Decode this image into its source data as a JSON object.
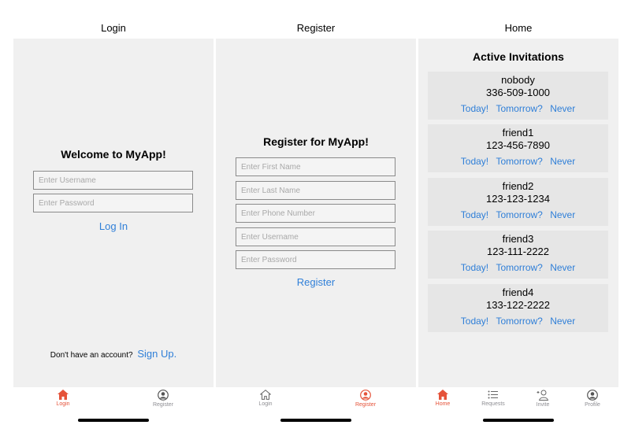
{
  "colors": {
    "accent": "#e5533a",
    "link": "#2f7fd8",
    "inactive": "#8e8e93",
    "background": "#f0f0f0"
  },
  "login": {
    "nav_title": "Login",
    "heading": "Welcome to MyApp!",
    "username_placeholder": "Enter Username",
    "password_placeholder": "Enter Password",
    "login_label": "Log In",
    "no_account_text": "Don't have an account?",
    "signup_label": "Sign Up.",
    "tabs": [
      {
        "label": "Login",
        "icon": "home-icon",
        "active": true
      },
      {
        "label": "Register",
        "icon": "user-circle-icon",
        "active": false
      }
    ]
  },
  "register": {
    "nav_title": "Register",
    "heading": "Register for MyApp!",
    "first_name_placeholder": "Enter First Name",
    "last_name_placeholder": "Enter Last Name",
    "phone_placeholder": "Enter Phone Number",
    "username_placeholder": "Enter Username",
    "password_placeholder": "Enter Password",
    "register_label": "Register",
    "tabs": [
      {
        "label": "Login",
        "icon": "home-icon",
        "active": false
      },
      {
        "label": "Register",
        "icon": "user-circle-icon",
        "active": true
      }
    ]
  },
  "home": {
    "nav_title": "Home",
    "heading": "Active Invitations",
    "invitations": [
      {
        "name": "nobody",
        "phone": "336-509-1000",
        "today": "Today!",
        "tomorrow": "Tomorrow?",
        "never": "Never"
      },
      {
        "name": "friend1",
        "phone": "123-456-7890",
        "today": "Today!",
        "tomorrow": "Tomorrow?",
        "never": "Never"
      },
      {
        "name": "friend2",
        "phone": "123-123-1234",
        "today": "Today!",
        "tomorrow": "Tomorrow?",
        "never": "Never"
      },
      {
        "name": "friend3",
        "phone": "123-111-2222",
        "today": "Today!",
        "tomorrow": "Tomorrow?",
        "never": "Never"
      },
      {
        "name": "friend4",
        "phone": "133-122-2222",
        "today": "Today!",
        "tomorrow": "Tomorrow?",
        "never": "Never"
      }
    ],
    "tabs": [
      {
        "label": "Home",
        "icon": "home-icon",
        "active": true
      },
      {
        "label": "Requests",
        "icon": "list-icon",
        "active": false
      },
      {
        "label": "Invite",
        "icon": "add-user-icon",
        "active": false
      },
      {
        "label": "Profile",
        "icon": "user-circle-icon",
        "active": false
      }
    ]
  }
}
